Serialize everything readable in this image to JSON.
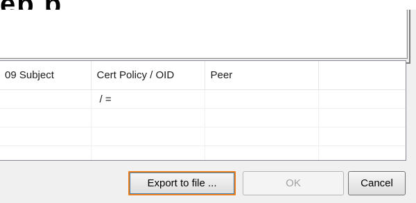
{
  "dialog": {
    "heading_cropped": "ep   p   "
  },
  "table": {
    "columns": [
      {
        "label": "09 Subject"
      },
      {
        "label": "Cert Policy / OID"
      },
      {
        "label": "Peer"
      },
      {
        "label": ""
      }
    ],
    "rows": [
      [
        "",
        " / =",
        "",
        ""
      ],
      [
        "",
        "",
        "",
        ""
      ],
      [
        "",
        "",
        "",
        ""
      ],
      [
        "",
        "",
        "",
        ""
      ]
    ]
  },
  "buttons": {
    "export_label": "Export to file ...",
    "ok_label": "OK",
    "cancel_label": "Cancel"
  },
  "colors": {
    "highlight_border": "#f07f1c",
    "disabled_text": "#a0a0a0"
  }
}
